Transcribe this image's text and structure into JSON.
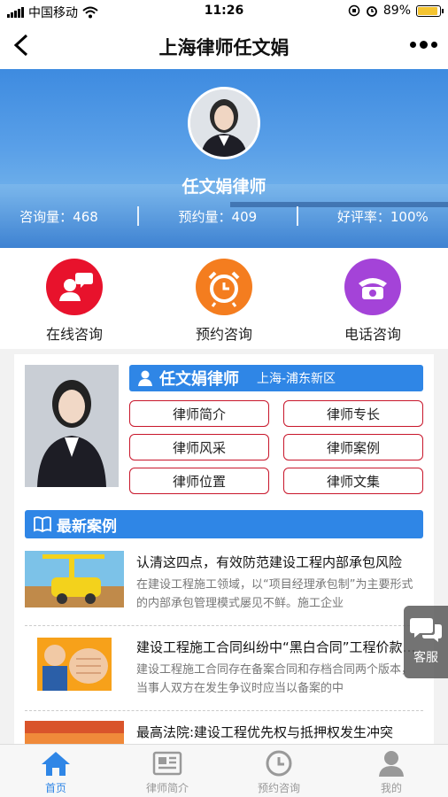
{
  "status_bar": {
    "carrier": "中国移动",
    "time": "11:26",
    "battery": "89%"
  },
  "nav": {
    "title": "上海律师任文娟"
  },
  "profile": {
    "name": "任文娟律师",
    "stats": [
      {
        "label": "咨询量：468"
      },
      {
        "label": "预约量：409"
      },
      {
        "label": "好评率：100%"
      }
    ]
  },
  "actions": [
    {
      "label": "在线咨询",
      "color": "#e8122c",
      "icon": "chat-bubble-person-icon"
    },
    {
      "label": "预约咨询",
      "color": "#f47d1f",
      "icon": "alarm-clock-icon"
    },
    {
      "label": "电话咨询",
      "color": "#a443d8",
      "icon": "telephone-icon"
    }
  ],
  "lawyer_card": {
    "name": "任文娟律师",
    "location": "上海-浦东新区",
    "buttons": [
      "律师简介",
      "律师专长",
      "律师风采",
      "律师案例",
      "律师位置",
      "律师文集"
    ]
  },
  "cases": {
    "header": "最新案例",
    "items": [
      {
        "title": "认清这四点，有效防范建设工程内部承包风险",
        "summary": "在建设工程施工领域，以“项目经理承包制”为主要形式的内部承包管理模式屡见不鲜。施工企业"
      },
      {
        "title": "建设工程施工合同纠纷中“黑白合同”工程价款的认定",
        "summary": "建设工程施工合同存在备案合同和存档合同两个版本，当事人双方在发生争议时应当以备案的中"
      },
      {
        "title": "最高法院:建设工程优先权与抵押权发生冲突",
        "summary": ""
      }
    ]
  },
  "floating": {
    "label": "客服"
  },
  "tabbar": [
    {
      "label": "首页",
      "active": true
    },
    {
      "label": "律师简介",
      "active": false
    },
    {
      "label": "预约咨询",
      "active": false
    },
    {
      "label": "我的",
      "active": false
    }
  ],
  "colors": {
    "primary": "#2f86e6",
    "button_border": "#c8162b"
  }
}
